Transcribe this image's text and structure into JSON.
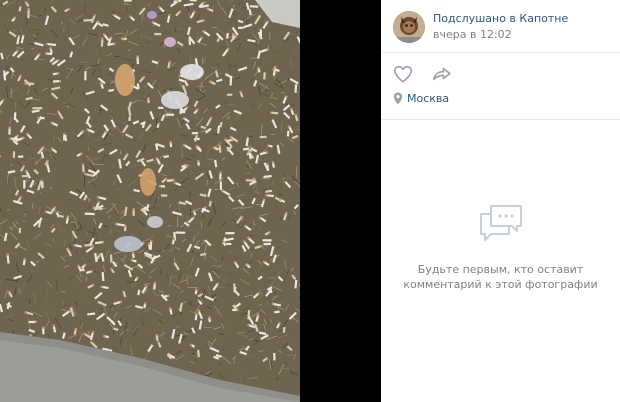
{
  "post": {
    "author": "Подслушано в Капотне",
    "date": "вчера в 12:02",
    "location": "Москва"
  },
  "comments": {
    "empty_line1": "Будьте первым, кто оставит",
    "empty_line2": "комментарий к этой фотографии"
  },
  "icons": {
    "like": "heart-icon",
    "share": "share-arrow-icon",
    "location": "map-pin-icon",
    "comments_empty": "speech-bubbles-icon"
  },
  "colors": {
    "link": "#2a5885",
    "muted": "#828282",
    "icon": "#99a2ad",
    "empty_icon": "#c5d0db"
  }
}
